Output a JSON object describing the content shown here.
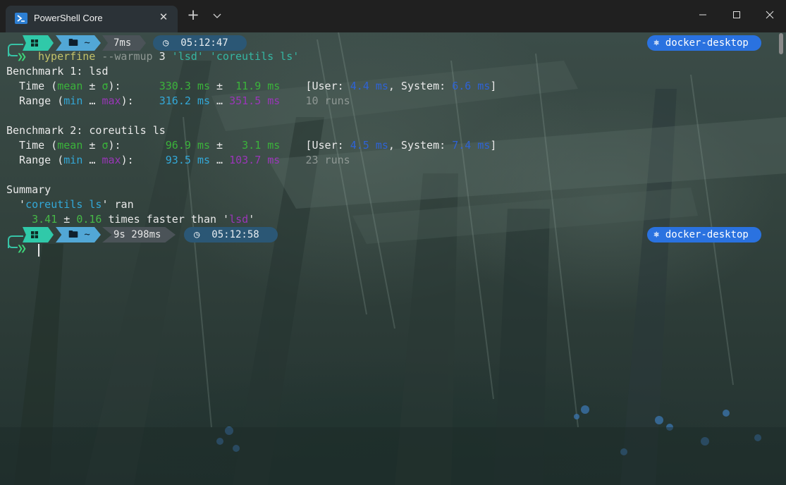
{
  "window": {
    "tab_title": "PowerShell Core",
    "tab_icon": "powershell-icon",
    "close_tab_glyph": "✕",
    "new_tab_glyph": "+",
    "dropdown_icon": "chevron-down-icon",
    "min_icon": "minimize-icon",
    "max_icon": "maximize-icon",
    "close_icon": "close-icon"
  },
  "prompt1": {
    "dir": "🖿 ~",
    "duration": "7ms",
    "time": "◷  05:12:47",
    "context": "⎈ docker-desktop",
    "chevrons": "❯❯",
    "command": "hyperfine",
    "args": [
      " --warmup",
      " 3",
      " 'lsd'",
      " 'coreutils ls'"
    ]
  },
  "bench1": {
    "header": "Benchmark 1: lsd",
    "time_label": "  Time (",
    "mean": "mean",
    "pm": " ± ",
    "sigma": "σ",
    "close": "):",
    "mean_value": "      330.3 ms",
    "pm2": " ± ",
    "sigma_value": " 11.9 ms",
    "user_open": "    [User: ",
    "user_value": "4.4 ms",
    "system_label": ", System: ",
    "system_value": "6.6 ms",
    "bracket_close": "]",
    "range_label": "  Range (",
    "min": "min",
    "ellipsis": " … ",
    "max": "max",
    "range_close": "):",
    "min_value": "    316.2 ms",
    "dots": " … ",
    "max_value": "351.5 ms",
    "runs": "    10 runs"
  },
  "bench2": {
    "header": "Benchmark 2: coreutils ls",
    "time_label": "  Time (",
    "mean": "mean",
    "pm": " ± ",
    "sigma": "σ",
    "close": "):",
    "mean_value": "       96.9 ms",
    "pm2": " ± ",
    "sigma_value": "  3.1 ms",
    "user_open": "    [User: ",
    "user_value": "4.5 ms",
    "system_label": ", System: ",
    "system_value": "7.4 ms",
    "bracket_close": "]",
    "range_label": "  Range (",
    "min": "min",
    "ellipsis": " … ",
    "max": "max",
    "range_close": "):",
    "min_value": "     93.5 ms",
    "dots": " … ",
    "max_value": "103.7 ms",
    "runs": "    23 runs"
  },
  "summary": {
    "header": "Summary",
    "q1": "  '",
    "fastest": "coreutils ls",
    "q2": "' ran",
    "indent": "    ",
    "ratio": "3.41",
    "pm": " ± ",
    "ratio_err": "0.16",
    "text": " times faster than '",
    "slowest": "lsd",
    "q3": "'"
  },
  "prompt2": {
    "dir": "🖿 ~",
    "duration": "9s 298ms",
    "time": "◷  05:12:58",
    "context": "⎈ docker-desktop",
    "chevrons": "❯❯"
  },
  "colors": {
    "accent_teal": "#30c9a9",
    "dir_blue": "#52a7d6",
    "time_navy": "#2b5775",
    "docker_blue": "#2a72e0"
  }
}
